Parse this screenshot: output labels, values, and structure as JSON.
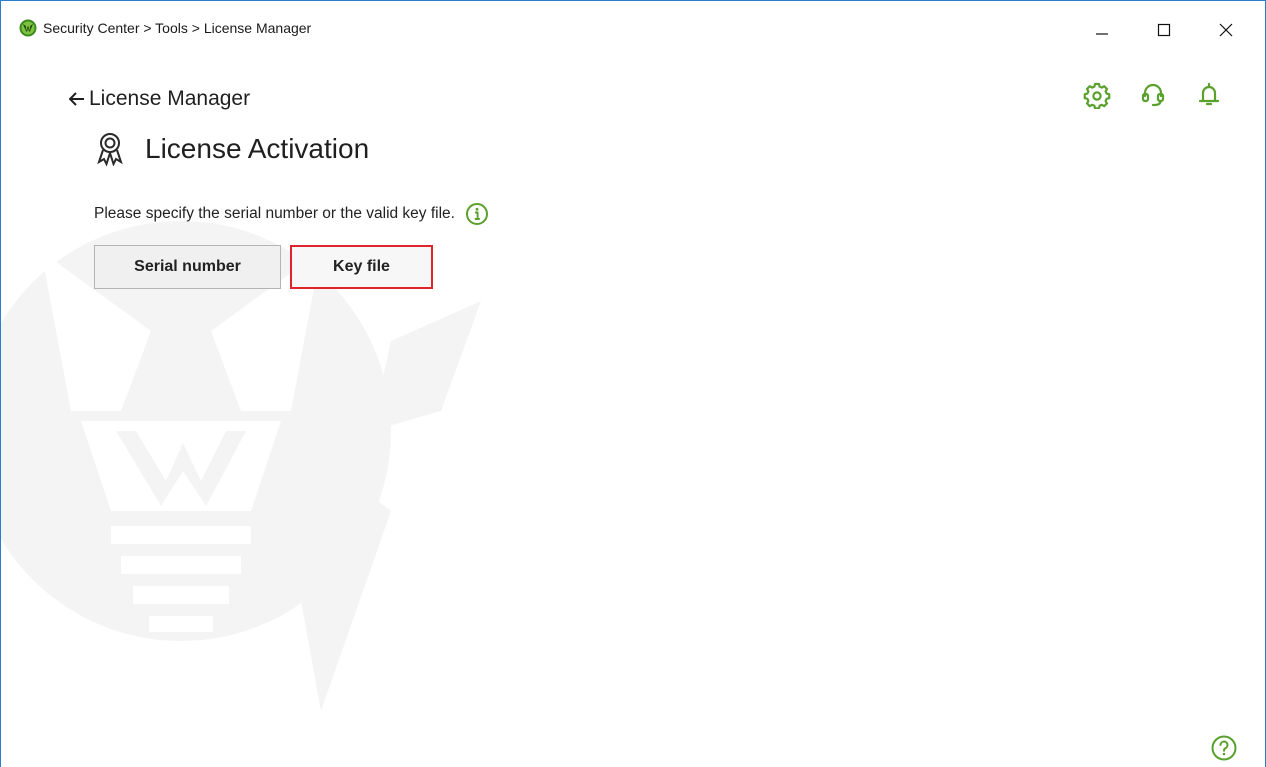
{
  "window": {
    "title": "Security Center > Tools > License Manager",
    "controls": {
      "minimize": "minimize-icon",
      "maximize": "maximize-icon",
      "close": "close-icon"
    }
  },
  "header_icons": [
    {
      "name": "gear-icon",
      "color": "#5aa02c"
    },
    {
      "name": "headset-icon",
      "color": "#5aa02c"
    },
    {
      "name": "bell-icon",
      "color": "#5aa02c"
    }
  ],
  "nav": {
    "back_label": "License Manager"
  },
  "page": {
    "title": "License Activation",
    "description": "Please specify the serial number or the valid key file."
  },
  "buttons": {
    "serial_number": "Serial number",
    "key_file": "Key file"
  },
  "colors": {
    "accent": "#5aa02c",
    "highlight_border": "#e0242c",
    "window_border": "#2b7fd0"
  }
}
